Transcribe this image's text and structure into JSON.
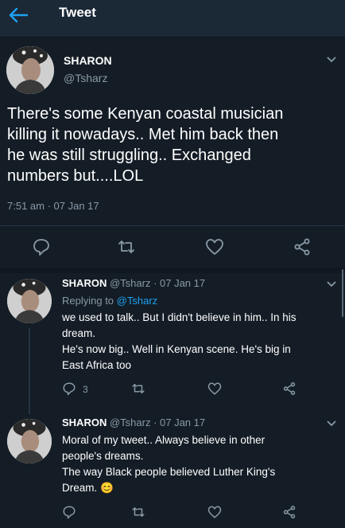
{
  "header": {
    "title": "Tweet",
    "back_icon": "back-arrow-icon",
    "accent": "#1da1f2"
  },
  "main_tweet": {
    "name": "SHARON",
    "handle": "@Tsharz",
    "lines": [
      "There's some Kenyan coastal musician",
      "killing it nowadays.. Met him back then",
      "he was still struggling.. Exchanged",
      "numbers but....LOL"
    ],
    "timestamp": "7:51 am · 07 Jan 17",
    "actions": [
      "reply-icon",
      "retweet-icon",
      "like-icon",
      "share-icon"
    ]
  },
  "replies": [
    {
      "name": "SHARON",
      "meta": "@Tsharz · 07 Jan 17",
      "replying_prefix": "Replying to ",
      "replying_to": "@Tsharz",
      "lines": [
        "we used to talk.. But I didn't believe in him.. In his",
        "dream.",
        "He's now big.. Well in Kenyan scene. He's big in",
        "East Africa too"
      ],
      "reply_count": "3"
    },
    {
      "name": "SHARON",
      "meta": "@Tsharz · 07 Jan 17",
      "lines": [
        "Moral of my tweet.. Always believe in other",
        "people's dreams.",
        "The way Black people believed Luther King's",
        "Dream."
      ],
      "emoji": "😊"
    }
  ]
}
